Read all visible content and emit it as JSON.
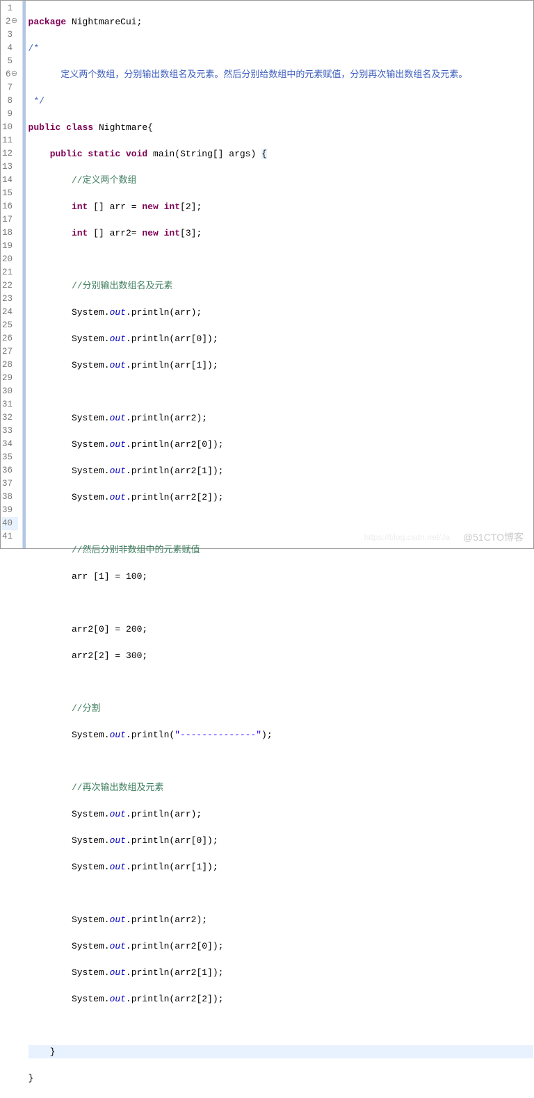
{
  "watermark": "@51CTO博客",
  "watermark2": "https://blog.csdn.net/Ja",
  "code": {
    "l1": "package NightmareCui;",
    "l2": "/*",
    "l3": "      定义两个数组，分别输出数组名及元素。然后分别给数组中的元素赋值，分别再次输出数组名及元素。",
    "l4": " */",
    "l5": "public class Nightmare{",
    "l6a": "    public static void main(String[] args) ",
    "l6b": "{",
    "l7": "        //定义两个数组",
    "l8": "        int [] arr = new int[2];",
    "l9": "        int [] arr2= new int[3];",
    "l10": "",
    "l11": "        //分别输出数组名及元素",
    "l12": "        System.out.println(arr);",
    "l13": "        System.out.println(arr[0]);",
    "l14": "        System.out.println(arr[1]);",
    "l15": "",
    "l16": "        System.out.println(arr2);",
    "l17": "        System.out.println(arr2[0]);",
    "l18": "        System.out.println(arr2[1]);",
    "l19": "        System.out.println(arr2[2]);",
    "l20": "",
    "l21": "        //然后分别非数组中的元素赋值",
    "l22": "        arr [1] = 100;",
    "l23": "",
    "l24": "        arr2[0] = 200;",
    "l25": "        arr2[2] = 300;",
    "l26": "",
    "l27": "        //分割",
    "l28": "        System.out.println(\"--------------\");",
    "l29": "",
    "l30": "        //再次输出数组及元素",
    "l31": "        System.out.println(arr);",
    "l32": "        System.out.println(arr[0]);",
    "l33": "        System.out.println(arr[1]);",
    "l34": "",
    "l35": "        System.out.println(arr2);",
    "l36": "        System.out.println(arr2[0]);",
    "l37": "        System.out.println(arr2[1]);",
    "l38": "        System.out.println(arr2[2]);",
    "l39": "",
    "l40": "    }",
    "l41": "}"
  },
  "gutter": {
    "n1": "1",
    "n2": "2",
    "n3": "3",
    "n4": "4",
    "n5": "5",
    "n6": "6",
    "n7": "7",
    "n8": "8",
    "n9": "9",
    "n10": "10",
    "n11": "11",
    "n12": "12",
    "n13": "13",
    "n14": "14",
    "n15": "15",
    "n16": "16",
    "n17": "17",
    "n18": "18",
    "n19": "19",
    "n20": "20",
    "n21": "21",
    "n22": "22",
    "n23": "23",
    "n24": "24",
    "n25": "25",
    "n26": "26",
    "n27": "27",
    "n28": "28",
    "n29": "29",
    "n30": "30",
    "n31": "31",
    "n32": "32",
    "n33": "33",
    "n34": "34",
    "n35": "35",
    "n36": "36",
    "n37": "37",
    "n38": "38",
    "n39": "39",
    "n40": "40",
    "n41": "41"
  },
  "tokens": {
    "package": "package",
    "public": "public",
    "class": "class",
    "static": "static",
    "void": "void",
    "int": "int",
    "new": "new",
    "main": "main",
    "String": "String",
    "args": "args",
    "Nightmare": "Nightmare",
    "NightmareCui": "NightmareCui",
    "System": "System",
    "out": "out",
    "println": "println",
    "arr": "arr",
    "arr2": "arr2",
    "n0": "0",
    "n1": "1",
    "n2": "2",
    "n3": "3",
    "n100": "100",
    "n200": "200",
    "n300": "300",
    "dashstr": "\"--------------\""
  }
}
